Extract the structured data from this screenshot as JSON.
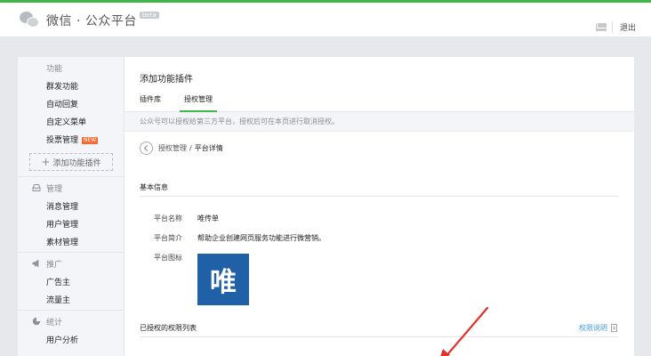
{
  "header": {
    "app_title": "微信 · 公众平台",
    "beta_badge": "beta",
    "logout_label": "退出"
  },
  "sidebar": {
    "groups": [
      {
        "title": "功能",
        "icon": "grid-icon",
        "items": [
          {
            "label": "群发功能"
          },
          {
            "label": "自动回复"
          },
          {
            "label": "自定义菜单"
          },
          {
            "label": "投票管理",
            "badge": "NEW"
          }
        ]
      },
      {
        "title": "管理",
        "icon": "inbox-icon",
        "items": [
          {
            "label": "消息管理"
          },
          {
            "label": "用户管理"
          },
          {
            "label": "素材管理"
          }
        ]
      },
      {
        "title": "推广",
        "icon": "megaphone-icon",
        "items": [
          {
            "label": "广告主"
          },
          {
            "label": "流量主"
          }
        ]
      },
      {
        "title": "统计",
        "icon": "pie-chart-icon",
        "items": [
          {
            "label": "用户分析"
          }
        ]
      }
    ],
    "add_plugin_label": "添加功能插件"
  },
  "main": {
    "title": "添加功能插件",
    "tabs": [
      {
        "label": "插件库",
        "active": false
      },
      {
        "label": "授权管理",
        "active": true
      }
    ],
    "notice": "公众号可以授权给第三方平台，授权后可在本页进行取消授权。",
    "breadcrumb": {
      "parent": "授权管理",
      "separator": "/",
      "current": "平台详情"
    },
    "basic_info": {
      "section_title": "基本信息",
      "name_label": "平台名称",
      "name_value": "唯传单",
      "intro_label": "平台简介",
      "intro_value": "帮助企业创建网页服务功能进行微营销。",
      "icon_label": "平台图标",
      "icon_glyph": "唯"
    },
    "permissions": {
      "section_title": "已授权的权限列表",
      "help_label": "权限说明"
    }
  },
  "colors": {
    "accent_green": "#44b549",
    "link_blue": "#459ae9",
    "platform_icon_bg": "#2060a6",
    "annotation_red": "#e0312b",
    "new_badge": "#f36b35"
  }
}
